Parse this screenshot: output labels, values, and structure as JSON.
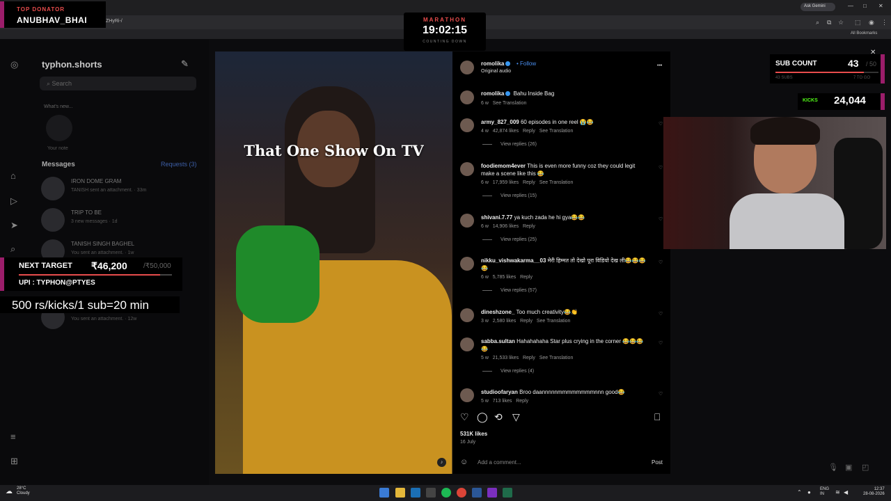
{
  "browser": {
    "url": "ZHyRi-/",
    "ask_gemini": "Ask Gemini",
    "all_bookmarks": "All Bookmarks",
    "min": "—",
    "max": "□",
    "close": "✕"
  },
  "donator": {
    "label": "TOP DONATOR",
    "name": "ANUBHAV_BHAI"
  },
  "marathon": {
    "label": "MARATHON",
    "time": "19:02:15",
    "sub": "COUNTING DOWN"
  },
  "ig_sidebar": {
    "account": "typhon.shorts",
    "search_placeholder": "Search",
    "note_prompt": "What's new...",
    "your_note": "Your note",
    "messages": "Messages",
    "requests": "Requests (3)",
    "threads": [
      {
        "name": "IRON DOME GRAM",
        "sub": "TANISH sent an attachment. · 33m"
      },
      {
        "name": "TRIP TO BE",
        "sub": "3 new messages · 1d"
      },
      {
        "name": "TANISH SINGH BAGHEL",
        "sub": "You sent an attachment. · 1w"
      },
      {
        "name": "",
        "sub": "You sent an attachment. · 12w"
      }
    ]
  },
  "target": {
    "label": "NEXT TARGET",
    "amount": "₹46,200",
    "goal": "/₹50,000",
    "progress": 0.924,
    "upi": "UPI : TYPHON@PTYES"
  },
  "kick_rate": "500 rs/kicks/1 sub=20 min",
  "video": {
    "caption": "That One Show On TV"
  },
  "post": {
    "author": "romolika",
    "follow": "Follow",
    "audio": "Original audio",
    "more": "•••",
    "caption_author": "romolika",
    "caption_text": "Bahu Inside Bag",
    "caption_age": "6 w",
    "caption_translate": "See Translation",
    "comments": [
      {
        "user": "army_827_009",
        "text": "60 episodes in one reel 😭😂",
        "age": "4 w",
        "likes": "42,874 likes",
        "reply": "Reply",
        "translate": "See Translation",
        "replies": "View replies (26)"
      },
      {
        "user": "foodiemom4ever",
        "text": "This is even more funny coz they could legit make a scene like this 😂",
        "age": "6 w",
        "likes": "17,959 likes",
        "reply": "Reply",
        "translate": "See Translation",
        "replies": "View replies (15)"
      },
      {
        "user": "shivani.7.77",
        "text": "ya kuch zada he hi gya😂😂",
        "age": "6 w",
        "likes": "14,906 likes",
        "reply": "Reply",
        "translate": "",
        "replies": "View replies (25)"
      },
      {
        "user": "nikku_vishwakarma__03",
        "text": "मेरी हिम्मत तो देखो पूरा विडियो देख ली😂😂😂😂",
        "age": "6 w",
        "likes": "5,785 likes",
        "reply": "Reply",
        "translate": "",
        "replies": "View replies (57)"
      },
      {
        "user": "dineshzone_",
        "text": "Too much creativity😂👏",
        "age": "3 w",
        "likes": "2,580 likes",
        "reply": "Reply",
        "translate": "See Translation",
        "replies": ""
      },
      {
        "user": "sabba.sultan",
        "text": "Hahahahaha Star plus crying in the corner 😂😂😂😂",
        "age": "5 w",
        "likes": "21,533 likes",
        "reply": "Reply",
        "translate": "See Translation",
        "replies": "View replies (4)"
      },
      {
        "user": "studioofaryan",
        "text": "Broo daannnnnmmmmmmmmnnn good😂",
        "age": "5 w",
        "likes": "713 likes",
        "reply": "Reply",
        "translate": "",
        "replies": ""
      }
    ],
    "likes": "531K likes",
    "date": "16 July",
    "add_comment": "Add a comment...",
    "post_btn": "Post"
  },
  "subcount": {
    "label": "SUB COUNT",
    "count": "43",
    "goal": "/ 50",
    "subs": "43 SUBS",
    "togo": "7 TO GO",
    "progress": 0.86
  },
  "kicks": {
    "label": "KICKS",
    "count": "24,044"
  },
  "taskbar": {
    "temp": "28°C",
    "weather": "Cloudy",
    "lang1": "ENG",
    "lang2": "IN",
    "time": "12:37",
    "date": "28-08-2026"
  },
  "colors": {
    "accent": "#9b1d6a",
    "red": "#e84c4c",
    "kick_green": "#53fc18",
    "ig_blue": "#3897f0"
  }
}
